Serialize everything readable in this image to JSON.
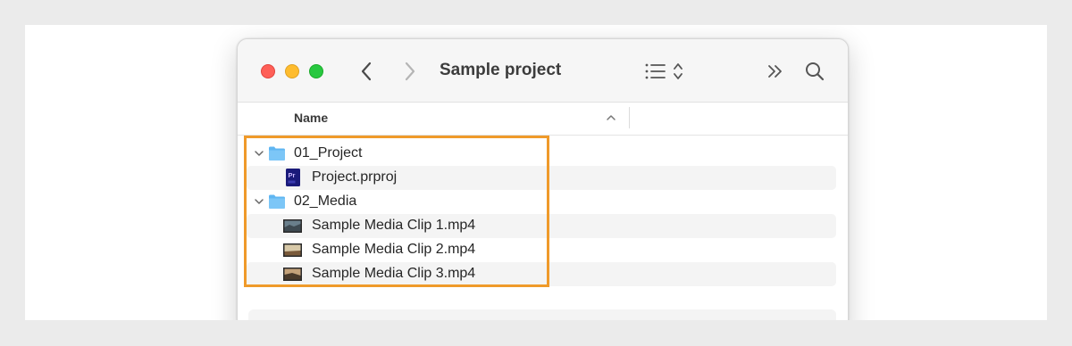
{
  "window": {
    "title": "Sample project"
  },
  "toolbar": {
    "back_icon": "chevron-left-icon",
    "forward_icon": "chevron-right-icon",
    "view_icon": "list-view-icon",
    "more_icon": "double-chevron-right-icon",
    "search_icon": "magnifying-glass-icon"
  },
  "columns": {
    "name_header": "Name",
    "sort": "ascending"
  },
  "files": [
    {
      "name": "01_Project",
      "kind": "folder",
      "expanded": true,
      "depth": 0
    },
    {
      "name": "Project.prproj",
      "kind": "premiere-project",
      "depth": 1,
      "badge": "Pr"
    },
    {
      "name": "02_Media",
      "kind": "folder",
      "expanded": true,
      "depth": 0
    },
    {
      "name": "Sample Media Clip 1.mp4",
      "kind": "video",
      "depth": 1
    },
    {
      "name": "Sample Media Clip 2.mp4",
      "kind": "video",
      "depth": 1
    },
    {
      "name": "Sample Media Clip 3.mp4",
      "kind": "video",
      "depth": 1
    }
  ],
  "colors": {
    "highlight": "#ef9a2a",
    "traffic_red": "#fe5f57",
    "traffic_yellow": "#febc2e",
    "traffic_green": "#28c840",
    "folder": "#5fb6f2",
    "premiere": "#1a1a7a"
  }
}
